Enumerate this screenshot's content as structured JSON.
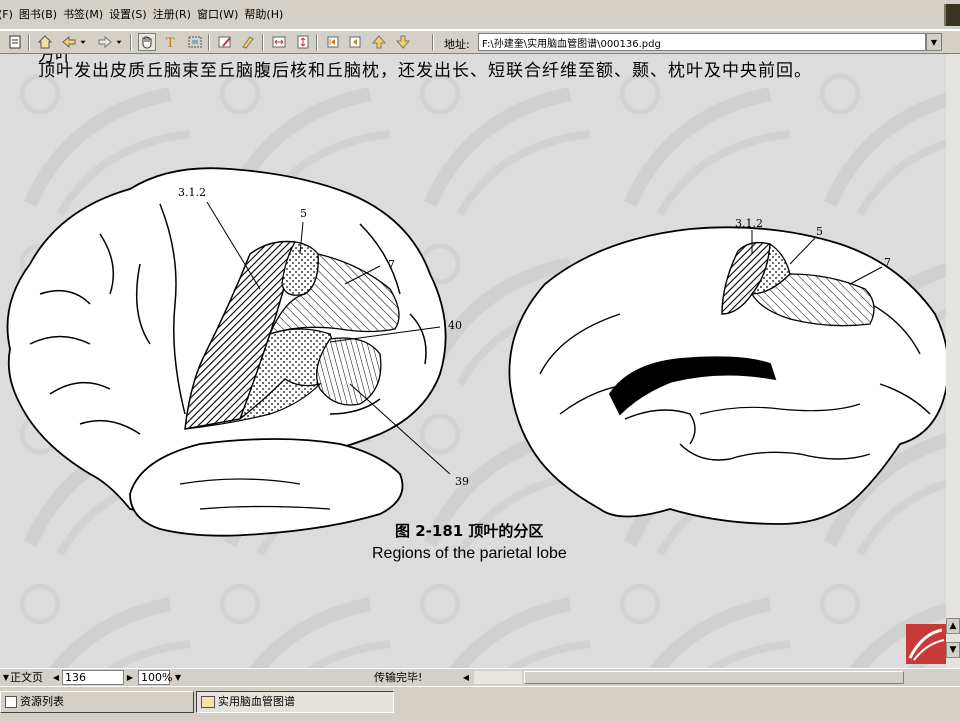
{
  "menu": {
    "items": [
      "(F)",
      "图书(B)",
      "书签(M)",
      "设置(S)",
      "注册(R)",
      "窗口(W)",
      "帮助(H)"
    ]
  },
  "toolbar": {
    "address_label": "地址:",
    "address_value": "F:\\孙建奎\\实用脑血管图谱\\000136.pdg"
  },
  "document": {
    "top_line_partial": "方叶",
    "top_line": "顶叶发出皮质丘脑束至丘脑腹后核和丘脑枕，还发出长、短联合纤维至额、颞、枕叶及中央前回。",
    "lateral_labels": [
      "3.1.2",
      "5",
      "7",
      "40",
      "39"
    ],
    "medial_labels": [
      "3.1.2",
      "5",
      "7"
    ],
    "caption_zh": "图 2-181   顶叶的分区",
    "caption_en": "Regions of the parietal lobe"
  },
  "status": {
    "page_type": "正文页",
    "page_number": "136",
    "zoom": "100%",
    "message": "传输完毕!"
  },
  "taskbar": {
    "items": [
      "资源列表",
      "实用脑血管图谱"
    ]
  },
  "colors": {
    "chrome": "#d4d0c8",
    "page": "#dcdcdc",
    "logo_red": "#c83a3a"
  }
}
